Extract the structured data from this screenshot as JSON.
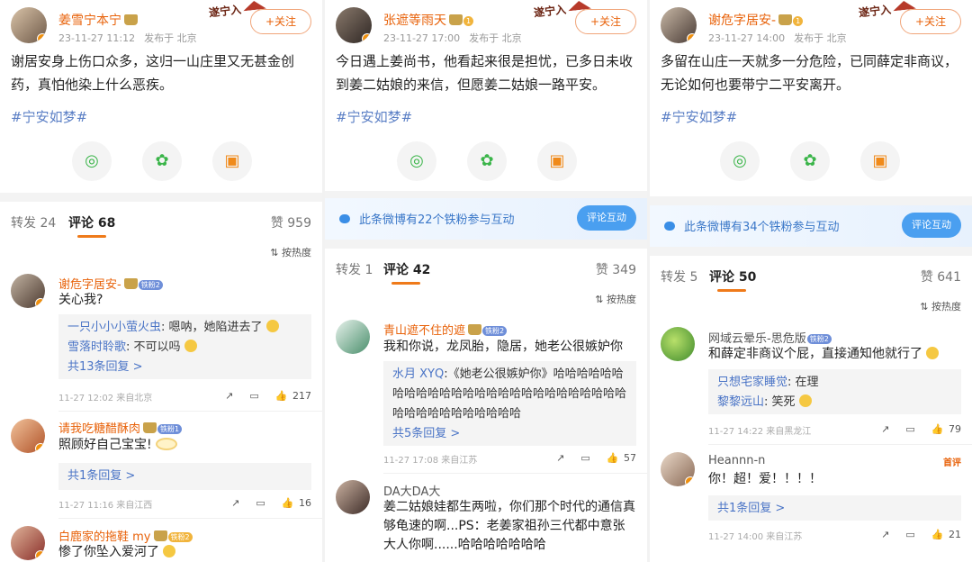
{
  "common": {
    "sticker": "遂宁入",
    "follow": "+关注",
    "topic": "#宁安如梦#",
    "sort": "按热度",
    "reply_tab": "转发",
    "comment_tab": "评论",
    "like_tab": "赞",
    "published": "发布于 北京",
    "fans_button": "评论互动",
    "share_icons": [
      "wechat-icon",
      "moments-icon",
      "save-image-icon"
    ]
  },
  "panels": [
    {
      "author": "姜雪宁本宁",
      "time": "23-11-27 11:12",
      "text": "谢居安身上伤口众多，这归一山庄里又无甚金创药，真怕他染上什么恶疾。",
      "reposts": "24",
      "comments": "68",
      "likes": "959",
      "comment_items": [
        {
          "name": "谢危字居安-",
          "level": "铁粉2",
          "text": "关心我?",
          "replies": [
            {
              "name": "一只小小小萤火虫",
              "text": ": 嗯呐，她陷进去了"
            },
            {
              "name": "雪落时聆歌",
              "text": ": 不可以吗"
            }
          ],
          "more": "共13条回复 >",
          "foot": "11-27 12:02  来自北京",
          "likes": "217"
        },
        {
          "name": "请我吃糖醋酥肉",
          "level": "铁粉1",
          "text": "照顾好自己宝宝!",
          "more": "共1条回复 >",
          "foot": "11-27 11:16  来自江西",
          "likes": "16"
        },
        {
          "name": "白鹿家的拖鞋 my",
          "level": "铁粉2",
          "text": "惨了你坠入爱河了"
        }
      ]
    },
    {
      "author": "张遮等雨天",
      "time": "23-11-27 17:00",
      "text": "今日遇上姜尚书，他看起来很是担忧，已多日未收到姜二姑娘的来信，但愿姜二姑娘一路平安。",
      "fans": "此条微博有22个铁粉参与互动",
      "reposts": "1",
      "comments": "42",
      "likes": "349",
      "comment_items": [
        {
          "name": "青山遮不住的遮",
          "level": "铁粉2",
          "text": "我和你说，龙凤胎，隐居，她老公很嫉妒你",
          "replies": [
            {
              "name": "水月 XYQ",
              "text": ":《她老公很嫉妒你》哈哈哈哈哈哈哈哈哈哈哈哈哈哈哈哈哈哈哈哈哈哈哈哈哈哈哈哈哈哈哈哈哈哈哈哈哈"
            }
          ],
          "more": "共5条回复 >",
          "foot": "11-27 17:08  来自江苏",
          "likes": "57"
        },
        {
          "name": "DA大DA大",
          "text": "姜二姑娘娃都生两啦，你们那个时代的通信真够龟速的啊...PS：老姜家祖孙三代都中意张大人你啊......哈哈哈哈哈哈哈"
        }
      ]
    },
    {
      "author": "谢危字居安-",
      "time": "23-11-27 14:00",
      "text": "多留在山庄一天就多一分危险，已同薛定非商议，无论如何也要带宁二平安离开。",
      "fans": "此条微博有34个铁粉参与互动",
      "reposts": "5",
      "comments": "50",
      "likes": "641",
      "comment_items": [
        {
          "name": "网域云晕乐-思危版",
          "level": "铁粉2",
          "text": "和薛定非商议个屁，直接通知他就行了",
          "replies": [
            {
              "name": "只想宅家睡觉",
              "text": ": 在理"
            },
            {
              "name": "黎黎远山",
              "text": ": 笑死"
            }
          ],
          "foot": "11-27 14:22  来自黑龙江",
          "likes": "79"
        },
        {
          "name": "Heannn-n",
          "badge": "首评",
          "text": "你！超！爱！！！！",
          "more": "共1条回复 >",
          "foot": "11-27 14:00  来自江苏",
          "likes": "21"
        }
      ]
    }
  ]
}
